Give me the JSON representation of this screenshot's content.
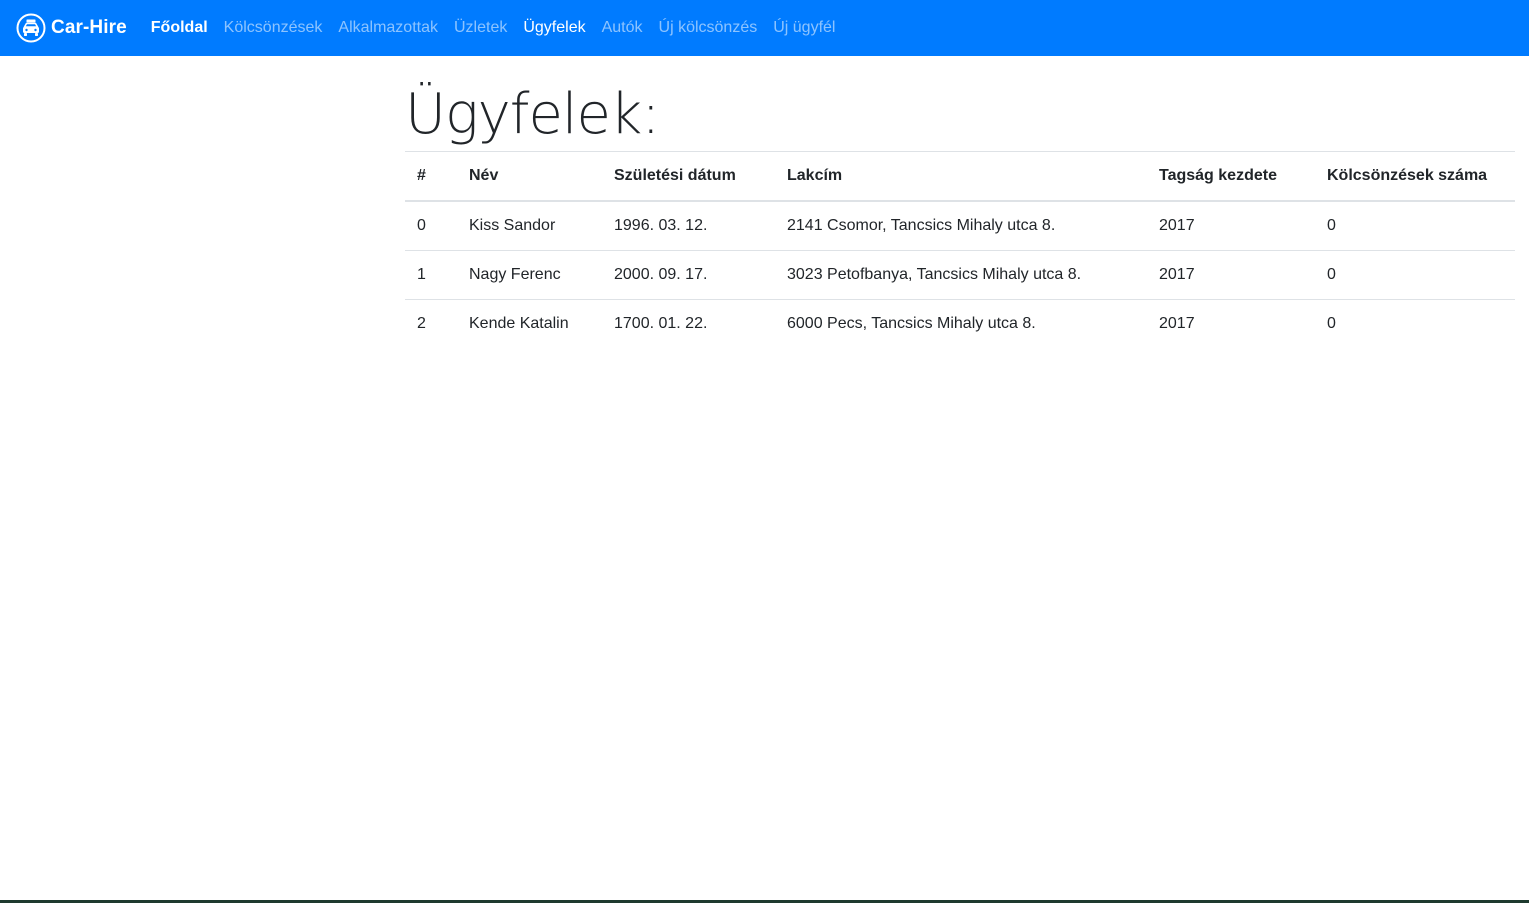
{
  "navbar": {
    "brand": "Car-Hire",
    "items": [
      {
        "label": "Főoldal"
      },
      {
        "label": "Kölcsönzések"
      },
      {
        "label": "Alkalmazottak"
      },
      {
        "label": "Üzletek"
      },
      {
        "label": "Ügyfelek"
      },
      {
        "label": "Autók"
      },
      {
        "label": "Új kölcsönzés"
      },
      {
        "label": "Új ügyfél"
      }
    ],
    "active": "Ügyfelek",
    "color": "#007bff"
  },
  "main": {
    "title": "Ügyfelek:",
    "table": {
      "headers": [
        "#",
        "Név",
        "Születési dátum",
        "Lakcím",
        "Tagság kezdete",
        "Kölcsönzések száma"
      ],
      "rows": [
        [
          "0",
          "Kiss Sandor",
          "1996. 03. 12.",
          "2141 Csomor, Tancsics Mihaly utca 8.",
          "2017",
          "0"
        ],
        [
          "1",
          "Nagy Ferenc",
          "2000. 09. 17.",
          "3023 Petofbanya, Tancsics Mihaly utca 8.",
          "2017",
          "0"
        ],
        [
          "2",
          "Kende Katalin",
          "1700. 01. 22.",
          "6000 Pecs, Tancsics Mihaly utca 8.",
          "2017",
          "0"
        ]
      ]
    }
  },
  "icons": {
    "brand_logo": "car-icon"
  }
}
